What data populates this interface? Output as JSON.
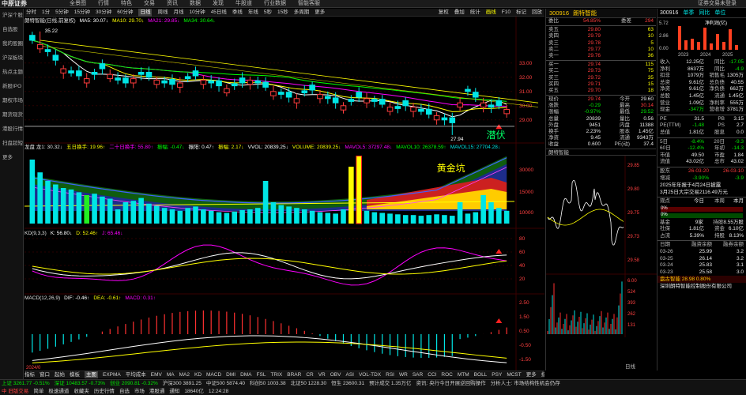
{
  "app": {
    "logo": "中原证券",
    "menu": [
      "全景图",
      "行情",
      "特色",
      "交易",
      "资讯",
      "数据",
      "发现",
      "牛股道",
      "行业数据",
      "智能客服"
    ],
    "top_right": "证券交易未登录"
  },
  "leftnav": [
    "沪深个股",
    "自选股",
    "我的股圈",
    "沪深板块",
    "热点主题",
    "新股IPO",
    "期权市场",
    "期货现货",
    "港股行情",
    "扫盘超短",
    "更多"
  ],
  "toolbar": {
    "left": [
      "分时",
      "1分",
      "5分钟",
      "15分钟",
      "30分钟",
      "60分钟",
      "日线",
      "周线",
      "月线",
      "10分钟",
      "45日线",
      "季线",
      "年线",
      "5秒",
      "15秒",
      "多周期",
      "更多"
    ],
    "active_left": "日线",
    "right": [
      "复权",
      "叠加",
      "统计",
      "画线",
      "F10",
      "标记",
      "回放"
    ],
    "active_right": "画线"
  },
  "info": {
    "price_line": [
      "朗特智能(日线,前复权)",
      "MA5: 30.07↓",
      "MA10: 29.70↓",
      "MA21: 29.85↓",
      "MA34: 30.64↓"
    ],
    "volume_line": [
      "龙盘 龙1: 30.32↓",
      "五日换手: 19.96↑",
      "二十日换手: 55.80↑",
      "振幅: -0.47↓",
      "振阳: 0.47↑",
      "振幅: 2.17↓",
      "VVOL: 20839.25↓",
      "VOLUME: 20839.25↓",
      "MAVOL5: 37297.48↓",
      "MAVOL10: 26378.59↑",
      "MAVOL15: 27704.28↓"
    ],
    "kdj_line": [
      "KD(9,3,3)",
      "K: 56.80↓",
      "D: 52.46↑",
      "J: 65.46↓"
    ],
    "macd_line": [
      "MACD(12,26,9)",
      "DIF: -0.46↑",
      "DEA: -0.61↑",
      "MACD: 0.31↑"
    ]
  },
  "chart_annotations": {
    "high_label": "35.22",
    "low_label": "27.94",
    "price_callout": "潜伏",
    "volume_callout": "黄金坑",
    "date_tick": "2024/0",
    "price_axis": [
      "33.00",
      "32.00",
      "31.00",
      "30.00",
      "29.00"
    ],
    "volume_axis": [
      "30000",
      "15000",
      "10000"
    ],
    "kdj_axis": [
      "80",
      "60",
      "40",
      "20"
    ],
    "macd_axis": [
      "2.50",
      "1.50",
      "0.50",
      "-0.50",
      "-1.50"
    ]
  },
  "indicators": [
    "指标",
    "窗口",
    "起始",
    "模板",
    "主图",
    "EXPMA",
    "平均成本",
    "EMV",
    "MA",
    "MA2",
    "KD",
    "MACD",
    "DMI",
    "DMA",
    "FSL",
    "TRIX",
    "BRAR",
    "CR",
    "VR",
    "OBV",
    "ASI",
    "VOL-TDX",
    "RSI",
    "WR",
    "SAR",
    "CCI",
    "ROC",
    "MTM",
    "BOLL",
    "PSY",
    "MCST",
    "更多",
    "指标"
  ],
  "indicators_active": "主图",
  "quote": {
    "code": "300916",
    "name": "朗特智能",
    "weibi": {
      "label": "委比",
      "value": "54.85%",
      "label2": "委差",
      "value2": "294"
    },
    "asks": [
      {
        "label": "卖五",
        "price": "29.80",
        "vol": "63"
      },
      {
        "label": "卖四",
        "price": "29.79",
        "vol": "10"
      },
      {
        "label": "卖三",
        "price": "29.78",
        "vol": "5"
      },
      {
        "label": "卖二",
        "price": "29.77",
        "vol": "10"
      },
      {
        "label": "卖一",
        "price": "29.76",
        "vol": "36"
      }
    ],
    "bids": [
      {
        "label": "买一",
        "price": "29.74",
        "vol": "115"
      },
      {
        "label": "买二",
        "price": "29.73",
        "vol": "75"
      },
      {
        "label": "买三",
        "price": "29.72",
        "vol": "35"
      },
      {
        "label": "买四",
        "price": "29.71",
        "vol": "15"
      },
      {
        "label": "买五",
        "price": "29.70",
        "vol": "18"
      }
    ],
    "stats": [
      {
        "k1": "现价",
        "v1": "29.74",
        "k2": "今开",
        "v2": "29.60"
      },
      {
        "k1": "涨跌",
        "v1": "-0.29",
        "k2": "最高",
        "v2": "30.14"
      },
      {
        "k1": "涨幅",
        "v1": "-0.97%",
        "k2": "最低",
        "v2": "29.52"
      },
      {
        "k1": "总量",
        "v1": "20839",
        "k2": "量比",
        "v2": "0.56"
      },
      {
        "k1": "外盘",
        "v1": "9451",
        "k2": "内盘",
        "v2": "11388"
      },
      {
        "k1": "换手",
        "v1": "2.23%",
        "k2": "股本",
        "v2": "1.45亿"
      },
      {
        "k1": "净资",
        "v1": "9.45",
        "k2": "流通",
        "v2": "9343万"
      },
      {
        "k1": "收益",
        "v1": "0.600",
        "k2": "PE(动)",
        "v2": "37.4"
      }
    ],
    "mini_title": "朗特智能",
    "mini_axis": [
      "29.85",
      "29.80",
      "29.75",
      "29.73",
      "29.58"
    ],
    "mini_vol_axis": [
      "6.00",
      "524",
      "393",
      "262",
      "131"
    ],
    "bottom_label": "日线"
  },
  "fin": {
    "code": "300916",
    "tabs": [
      "单季",
      "同比",
      "单位"
    ],
    "bar_axis": [
      "5.72",
      "2.86",
      "0.00"
    ],
    "bar_legend": "净利润(亿)",
    "bar_years": [
      "2023",
      "2024",
      "2025"
    ],
    "rows": [
      {
        "k1": "收入",
        "v1": "12.25亿",
        "k2": "同比",
        "v2": "-17.05"
      },
      {
        "k1": "净利",
        "v1": "8637万",
        "k2": "同比",
        "v2": "-4.9"
      },
      {
        "k1": "扣非",
        "v1": "1079万",
        "k2": "销售毛",
        "v2": "1305万"
      },
      {
        "k1": "总资",
        "v1": "9.61亿",
        "k2": "总负债",
        "v2": "40.55"
      },
      {
        "k1": "净资",
        "v1": "9.61亿",
        "k2": "净负债",
        "v2": "662万"
      },
      {
        "k1": "总股",
        "v1": "1.45亿",
        "k2": "流通",
        "v2": "1.45亿"
      },
      {
        "k1": "营业",
        "v1": "1.09亿",
        "k2": "净利率",
        "v2": "555万"
      },
      {
        "k1": "现金",
        "v1": "-347万",
        "k2": "营收增",
        "v2": "3781万"
      }
    ],
    "rows2": [
      {
        "k1": "PE",
        "v1": "31.5",
        "k2": "PB",
        "v2": "3.15"
      },
      {
        "k1": "PE(TTM)",
        "v1": "-1.48",
        "k2": "PS",
        "v2": "2.7"
      },
      {
        "k1": "总值",
        "v1": "1.81亿",
        "k2": "股息",
        "v2": "0.0"
      }
    ],
    "rows3": [
      {
        "k1": "5日",
        "v1": "-8.4%",
        "k2": "20日",
        "v2": "-9.3"
      },
      {
        "k1": "60日",
        "v1": "-12.4%",
        "k2": "年初",
        "v2": "-14.3"
      },
      {
        "k1": "市值",
        "v1": "49.50",
        "k2": "市盈",
        "v2": "1.84"
      },
      {
        "k1": "流值",
        "v1": "43.02亿",
        "k2": "总市",
        "v2": "43.02"
      }
    ],
    "dates": {
      "k": "股东",
      "v1": "26-03-20",
      "v2": "26-03-10"
    },
    "dates2": {
      "k": "增减",
      "v1": "-3.90%",
      "v2": "-3.9"
    },
    "notice1": "2025年年报于4月24日披露",
    "notice2": "3月25日大宗交易2116.49万元",
    "rating": {
      "k": "观点",
      "v1": "今日",
      "v2": "本周",
      "v3": "本月"
    },
    "rating_bars": [
      "0%",
      "0%"
    ],
    "fund_rows": [
      {
        "k1": "基金",
        "v1": "9家",
        "k2": "持股",
        "v2": "8.55万股"
      },
      {
        "k1": "社保",
        "v1": "1.81亿",
        "k2": "资金",
        "v2": "6.10亿"
      },
      {
        "k1": "占流",
        "v1": "5.39%",
        "k2": "持股",
        "v2": "8.13%"
      }
    ],
    "margin_head": [
      "日期",
      "融资余额",
      "融券余额"
    ],
    "margin_rows": [
      {
        "d": "03-26",
        "v1": "25.99",
        "v2": "3.2"
      },
      {
        "d": "03-25",
        "v1": "26.14",
        "v2": "3.2"
      },
      {
        "d": "03-24",
        "v1": "25.83",
        "v2": "3.1"
      },
      {
        "d": "03-23",
        "v1": "25.58",
        "v2": "3.0"
      }
    ],
    "footer": "盘古智能  28.98  0.80%",
    "footer2": "深圳朗特智能控制股份有限公司"
  },
  "status": {
    "line1": [
      "上证 3261.77 -0.51%",
      "深证 10483.57 -0.73%",
      "创业 2090.81 -0.32%",
      "沪深300 3891.25",
      "中证500 5874.40",
      "科创50 1003.38",
      "北证50 1228.30",
      "恒生 23600.31",
      "预计成交 1.35万亿",
      "资讯: 央行今日开展逆回购操作",
      "分析人士: 市场结构性机会仍存"
    ],
    "line2": [
      "中 旧版交易",
      "简单",
      "极速通道",
      "收藏夹",
      "历史行情",
      "自选",
      "市场",
      "港股通",
      "通知",
      "18640亿",
      "12:24:28"
    ]
  },
  "colors": {
    "up": "#ff3c3c",
    "down": "#00e5e5",
    "ma5": "#ffffff",
    "ma10": "#ffff00",
    "ma21": "#ff00ff",
    "ma34": "#00ff00",
    "callout": "#00ff66",
    "callout2": "#ffff00"
  }
}
